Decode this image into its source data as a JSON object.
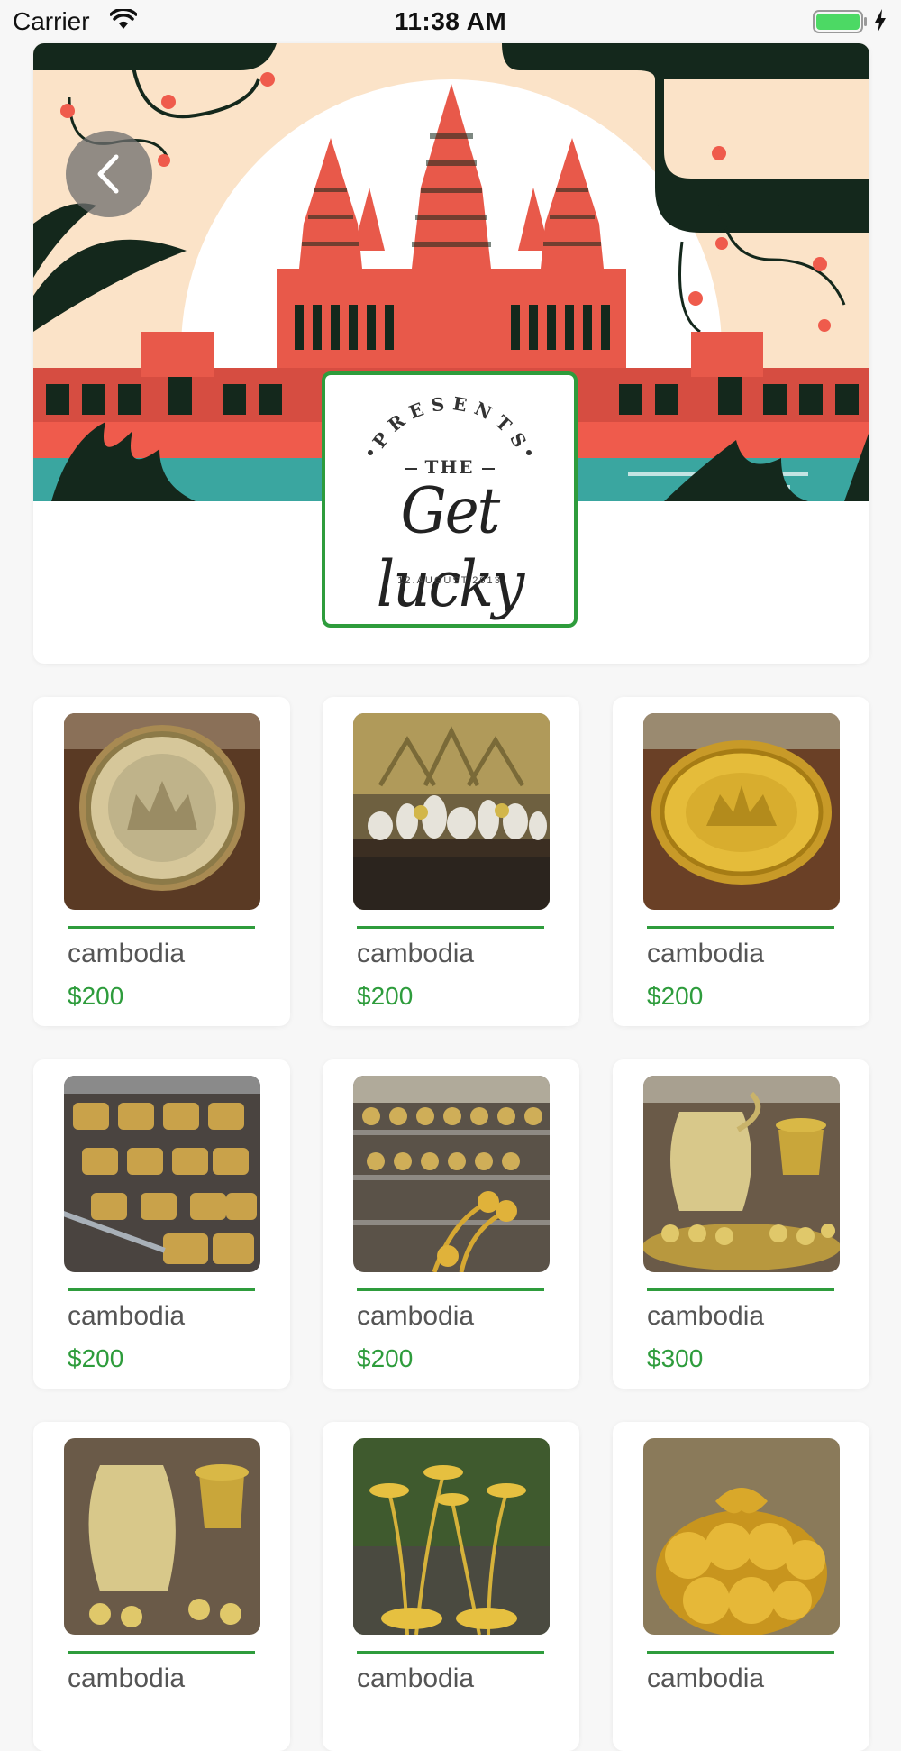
{
  "status_bar": {
    "carrier": "Carrier",
    "time": "11:38 AM",
    "battery_color": "#4cd964"
  },
  "header": {
    "logo": {
      "presents": "PRESENTS",
      "the": "THE",
      "title": "Get lucky",
      "date": "12.AUGUST.2013",
      "border_color": "#2e9c3c"
    }
  },
  "products": [
    {
      "name": "cambodia",
      "price": "$200",
      "image": "silver-ornate-plate"
    },
    {
      "name": "cambodia",
      "price": "$200",
      "image": "silverware-display-table"
    },
    {
      "name": "cambodia",
      "price": "$200",
      "image": "gold-oval-tray"
    },
    {
      "name": "cambodia",
      "price": "$200",
      "image": "gold-bowls-shelves"
    },
    {
      "name": "cambodia",
      "price": "$200",
      "image": "gold-lotus-shop-shelves"
    },
    {
      "name": "cambodia",
      "price": "$300",
      "image": "gold-teapot-set"
    },
    {
      "name": "cambodia",
      "price": "",
      "image": "gold-teapot-set"
    },
    {
      "name": "cambodia",
      "price": "",
      "image": "gold-lotus-sculpture"
    },
    {
      "name": "cambodia",
      "price": "",
      "image": "gold-ornate-box"
    }
  ],
  "accent_color": "#2e9c3c"
}
